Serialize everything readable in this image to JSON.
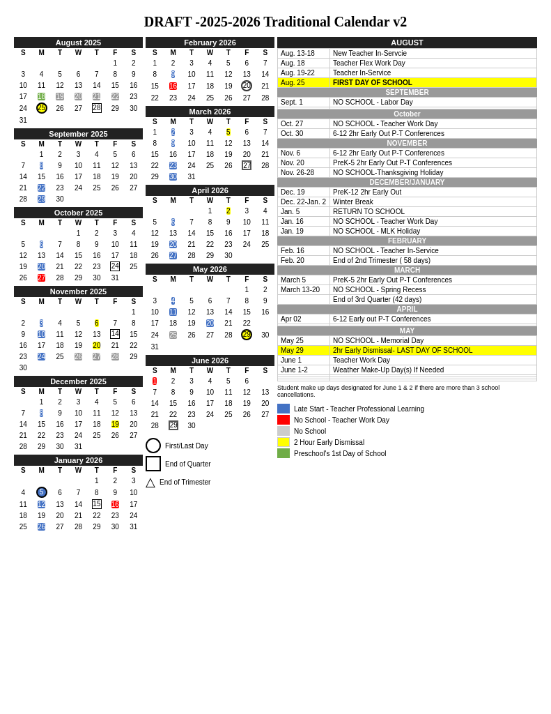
{
  "title": "DRAFT -2025-2026 Traditional Calendar v2",
  "months": {
    "aug2025": {
      "name": "August 2025",
      "days": [
        "",
        "",
        "",
        "",
        "1",
        "2",
        "",
        "3",
        "4",
        "5",
        "6",
        "7",
        "8",
        "9",
        "10",
        "11",
        "12",
        "13",
        "14",
        "15",
        "16",
        "17",
        "18",
        "19",
        "20",
        "21",
        "22",
        "23",
        "24",
        "25",
        "26",
        "27",
        "28",
        "29",
        "30",
        "",
        "31"
      ]
    },
    "sep2025": {
      "name": "September 2025"
    },
    "oct2025": {
      "name": "October 2025"
    },
    "nov2025": {
      "name": "November 2025"
    },
    "dec2025": {
      "name": "December 2025"
    },
    "jan2026": {
      "name": "January 2026"
    },
    "feb2026": {
      "name": "February 2026"
    },
    "mar2026": {
      "name": "March 2026"
    },
    "apr2026": {
      "name": "April 2026"
    },
    "may2026": {
      "name": "May 2026"
    },
    "jun2026": {
      "name": "June 2026"
    }
  },
  "events": {
    "august_header": "AUGUST",
    "september_header": "SEPTEMBER",
    "october_header": "October",
    "november_header": "NOVEMBER",
    "december_header": "DECEMBER/JANUARY",
    "february_header": "FEBRUARY",
    "march_header": "MARCH",
    "april_header": "APRIL",
    "may_header": "MAY",
    "rows": [
      {
        "date": "Aug. 13-18",
        "event": "New Teacher In-Servcie",
        "style": ""
      },
      {
        "date": "Aug. 18",
        "event": "Teacher Flex Work Day",
        "style": ""
      },
      {
        "date": "Aug. 19-22",
        "event": "Teacher In-Service",
        "style": ""
      },
      {
        "date": "Aug. 25",
        "event": "FIRST DAY OF SCHOOL",
        "style": "yellow"
      },
      {
        "date": "Sept. 1",
        "event": "NO SCHOOL - Labor Day",
        "style": ""
      },
      {
        "date": "",
        "event": "",
        "style": ""
      },
      {
        "date": "Oct. 27",
        "event": "NO SCHOOL - Teacher Work Day",
        "style": ""
      },
      {
        "date": "Oct. 30",
        "event": "6-12 2hr Early Out P-T Conferences",
        "style": ""
      },
      {
        "date": "Nov. 6",
        "event": "6-12 2hr Early Out P-T Conferences",
        "style": ""
      },
      {
        "date": "Nov. 20",
        "event": "PreK-5 2hr Early Out P-T Conferences",
        "style": ""
      },
      {
        "date": "Nov. 26-28",
        "event": "NO SCHOOL-Thanksgiving Holiday",
        "style": ""
      },
      {
        "date": "Dec. 19",
        "event": "PreK-12 2hr Early Out",
        "style": ""
      },
      {
        "date": "Dec. 22-Jan. 2",
        "event": "Winter Break",
        "style": ""
      },
      {
        "date": "Jan. 5",
        "event": "RETURN TO SCHOOL",
        "style": ""
      },
      {
        "date": "Jan. 16",
        "event": "NO SCHOOL - Teacher Work Day",
        "style": ""
      },
      {
        "date": "Jan. 19",
        "event": "NO SCHOOL - MLK Holiday",
        "style": ""
      },
      {
        "date": "Feb. 16",
        "event": "NO SCHOOL - Teacher In-Service",
        "style": ""
      },
      {
        "date": "Feb. 20",
        "event": "End of 2nd Trimester ( 58 days)",
        "style": ""
      },
      {
        "date": "March 5",
        "event": "PreK-5 2hr Early Out P-T Conferences",
        "style": ""
      },
      {
        "date": "March 13-20",
        "event": "NO SCHOOL - Spring Recess",
        "style": ""
      },
      {
        "date": "",
        "event": "End of 3rd Quarter (42 days)",
        "style": ""
      },
      {
        "date": "Apr 02",
        "event": "6-12 Early out P-T Conferences",
        "style": ""
      },
      {
        "date": "",
        "event": "",
        "style": ""
      },
      {
        "date": "May 25",
        "event": "NO SCHOOL - Memorial Day",
        "style": ""
      },
      {
        "date": "May 29",
        "event": "2hr Early Dismissal- LAST DAY OF SCHOOL",
        "style": "yellow"
      },
      {
        "date": "June 1",
        "event": "Teacher Work Day",
        "style": ""
      },
      {
        "date": "June 1-2",
        "event": "Weather Make-Up Day(s) If Needed",
        "style": ""
      },
      {
        "date": "",
        "event": "",
        "style": ""
      },
      {
        "date": "",
        "event": "",
        "style": ""
      }
    ]
  },
  "legend": {
    "symbols": [
      {
        "symbol": "circle",
        "label": "First/Last Day"
      },
      {
        "symbol": "square",
        "label": "End of Quarter"
      },
      {
        "symbol": "triangle",
        "label": "End of Trimester"
      }
    ],
    "colors": [
      {
        "color": "#4472C4",
        "label": "Late Start - Teacher Professional Learning"
      },
      {
        "color": "#FF0000",
        "label": "No School - Teacher Work Day"
      },
      {
        "color": "#cccccc",
        "label": "No School"
      },
      {
        "color": "#FFFF00",
        "label": "2 Hour Early Dismissal"
      },
      {
        "color": "#70AD47",
        "label": "Preschool's 1st Day of School"
      }
    ]
  },
  "note": "Student make up days designated for June 1 & 2 if there are more than 3 school cancellations."
}
